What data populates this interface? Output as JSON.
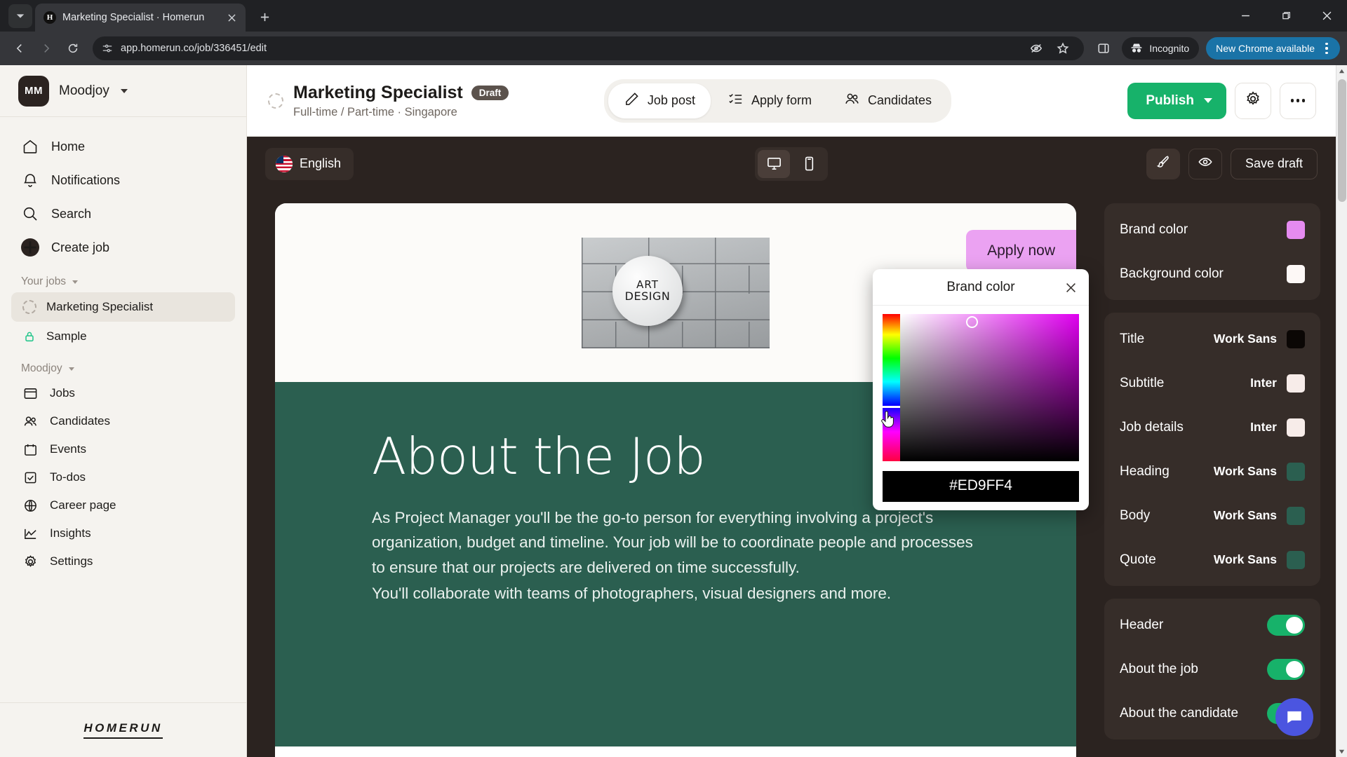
{
  "browser": {
    "tab": {
      "title": "Marketing Specialist · Homerun",
      "favicon_letter": "H"
    },
    "url": "app.homerun.co/job/336451/edit",
    "incognito_label": "Incognito",
    "update_label": "New Chrome available",
    "icons": {
      "tab_search": "tab-search-icon",
      "new_tab": "new-tab-icon",
      "back": "back-arrow-icon",
      "forward": "forward-arrow-icon",
      "reload": "reload-icon",
      "site_info": "site-settings-icon",
      "tracking": "eye-off-icon",
      "bookmark": "star-icon",
      "side_panel": "side-panel-icon",
      "minimize": "minimize-icon",
      "maximize": "maximize-icon",
      "close": "close-icon"
    }
  },
  "sidebar": {
    "org": {
      "initials": "MM",
      "name": "Moodjoy"
    },
    "nav": [
      {
        "label": "Home",
        "icon": "home-icon"
      },
      {
        "label": "Notifications",
        "icon": "bell-icon"
      },
      {
        "label": "Search",
        "icon": "search-icon"
      },
      {
        "label": "Create job",
        "icon": "plus-circle-icon"
      }
    ],
    "your_jobs_label": "Your jobs",
    "jobs": [
      {
        "label": "Marketing Specialist",
        "icon": "draft-spinner-icon",
        "active": true
      },
      {
        "label": "Sample",
        "icon": "lock-icon",
        "active": false
      }
    ],
    "workspace_label": "Moodjoy",
    "workspace_nav": [
      {
        "label": "Jobs",
        "icon": "board-icon"
      },
      {
        "label": "Candidates",
        "icon": "people-icon"
      },
      {
        "label": "Events",
        "icon": "calendar-icon"
      },
      {
        "label": "To-dos",
        "icon": "checkbox-icon"
      },
      {
        "label": "Career page",
        "icon": "globe-icon"
      },
      {
        "label": "Insights",
        "icon": "chart-line-icon"
      },
      {
        "label": "Settings",
        "icon": "gear-icon"
      }
    ],
    "brand": "HOMERUN"
  },
  "job_header": {
    "title": "Marketing Specialist",
    "status_badge": "Draft",
    "subtitle": "Full-time / Part-time · Singapore",
    "tabs": [
      {
        "label": "Job post",
        "icon": "pencil-icon",
        "active": true
      },
      {
        "label": "Apply form",
        "icon": "checklist-icon",
        "active": false
      },
      {
        "label": "Candidates",
        "icon": "people-icon",
        "active": false
      }
    ],
    "publish_label": "Publish",
    "settings_icon": "gear-icon",
    "more_icon": "more-horizontal-icon"
  },
  "editor_bar": {
    "language": "English",
    "language_flag": "us-flag-icon",
    "devices": [
      {
        "name": "desktop-icon",
        "active": true
      },
      {
        "name": "mobile-icon",
        "active": false
      }
    ],
    "brush_icon": "paintbrush-icon",
    "preview_icon": "eye-icon",
    "save_draft_label": "Save draft"
  },
  "preview": {
    "apply_button": "Apply now",
    "logo_line1": "ART",
    "logo_line2": "DESIGN",
    "heading": "About the Job",
    "paragraph1": "As Project Manager you'll be the go-to person for everything involving a project's organization, budget and timeline. Your job will be to coordinate people and processes to ensure that our projects are delivered on time successfully.",
    "paragraph2": "You'll collaborate with teams of photographers, visual designers and more."
  },
  "color_picker": {
    "title": "Brand color",
    "hex": "#ED9FF4",
    "close_icon": "close-icon"
  },
  "rail": {
    "colors": [
      {
        "label": "Brand color",
        "swatch": "#e58bf0"
      },
      {
        "label": "Background color",
        "swatch": "#fdf8f6"
      }
    ],
    "typography": [
      {
        "label": "Title",
        "font": "Work Sans",
        "swatch": "#0b0705"
      },
      {
        "label": "Subtitle",
        "font": "Inter",
        "swatch": "#f7ece9"
      },
      {
        "label": "Job details",
        "font": "Inter",
        "swatch": "#f7ece9"
      },
      {
        "label": "Heading",
        "font": "Work Sans",
        "swatch": "#2b5f50"
      },
      {
        "label": "Body",
        "font": "Work Sans",
        "swatch": "#2b5f50"
      },
      {
        "label": "Quote",
        "font": "Work Sans",
        "swatch": "#2b5f50"
      }
    ],
    "sections": [
      {
        "label": "Header",
        "enabled": true
      },
      {
        "label": "About the job",
        "enabled": true
      },
      {
        "label": "About the candidate",
        "enabled": true
      }
    ]
  },
  "theme": {
    "accent_green": "#17b26a",
    "preview_green": "#2b5f50",
    "brand_pink": "#eba2f2",
    "dark_panel": "#2b2320"
  }
}
